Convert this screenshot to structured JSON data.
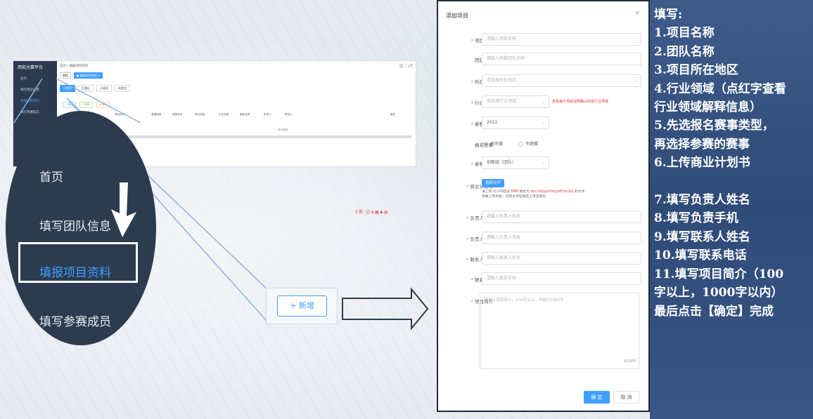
{
  "mini_screenshot": {
    "logo": "西软大赛平台",
    "sidebar": [
      "首页",
      "填写团队信息",
      "填报项目资料",
      "填写参赛成员"
    ],
    "breadcrumb": "首页 / 填报项目资料",
    "tag_home": "首页",
    "tag_current": "● 填报项目资料 ×",
    "tabs": [
      "已提交",
      "已通过",
      "已退回",
      "未提交"
    ],
    "actions": [
      "+ 新增",
      "✎ 修改",
      "✖ 删除"
    ],
    "columns": [
      "序号",
      "赛事",
      "项目名称",
      "参赛组别",
      "参赛年份",
      "所在地区",
      "行业领域",
      "团队名称",
      "负责人",
      "联系人",
      "操作"
    ],
    "empty": "暂无数据",
    "top_icons": "Q ⛶ rT"
  },
  "magnifier": {
    "items": [
      "首页",
      "填写团队信息",
      "填报项目资料",
      "填写参赛成员"
    ]
  },
  "new_button": "+ 新增",
  "toolbar_icons": "S英·☺⊕▦♟▤",
  "dialog": {
    "title": "添加项目",
    "close": "×",
    "fields": {
      "project_name": {
        "label": "项目名称",
        "placeholder": "请输入项目名称"
      },
      "team_name": {
        "label": "团队名称",
        "placeholder": "请输入所属团队名称"
      },
      "region": {
        "label": "所在地区",
        "placeholder": "请选择所在地区"
      },
      "industry": {
        "label": "行业领域",
        "placeholder": "请选择行业领域",
        "hint": "查看每分领域说明确认所属行业领域"
      },
      "year": {
        "label": "参赛年份",
        "value": "2022"
      },
      "event": {
        "label": "报名赛事",
        "options": [
          "地市赛",
          "专题赛"
        ]
      },
      "group": {
        "label": "参赛组别",
        "value": "创客组（团队）"
      },
      "plan": {
        "label": "商业计划书",
        "button": "选取文件",
        "tip1a": "请上传 大小不超过 ",
        "tip1b": "5MB",
        "tip1c": " 格式为 ",
        "tip1d": "doc/xls/ppt/txt/pdf/rar/zip",
        "tip1e": " 的文件",
        "tip2": "如果上传失败，可将文件压缩后上传压缩包"
      },
      "leader_name": {
        "label": "负责人姓名",
        "placeholder": "请输入负责人姓名"
      },
      "leader_phone": {
        "label": "负责人手机",
        "placeholder": "请输入负责人手机"
      },
      "contact_name": {
        "label": "联系人姓名",
        "placeholder": "请输入联系人姓名"
      },
      "contact_phone": {
        "label": "联系手机",
        "placeholder": "请输入联系手机"
      },
      "intro": {
        "label": "项目简介",
        "placeholder": "请输入项目简介，100字以上，不超过1000字",
        "counter": "0/1000"
      }
    },
    "ok": "确 定",
    "cancel": "取 消"
  },
  "instructions": [
    "填写:",
    "1.项目名称",
    "2.团队名称",
    "3.项目所在地区",
    "4.行业领域（点红字查看",
    "行业领域解释信息）",
    "5.先选报名赛事类型，",
    "再选择参赛的赛事",
    "6.上传商业计划书",
    "",
    "7.填写负责人姓名",
    "8.填写负责手机",
    "9.填写联系人姓名",
    "10.填写联系电话",
    "11.填写项目简介（100",
    "字以上，1000字以内）",
    "最后点击【确定】完成"
  ],
  "colors": {
    "accent": "#409eff",
    "sidebar": "#2d3b4f",
    "panel": "#34507f",
    "required": "#f56c6c"
  }
}
